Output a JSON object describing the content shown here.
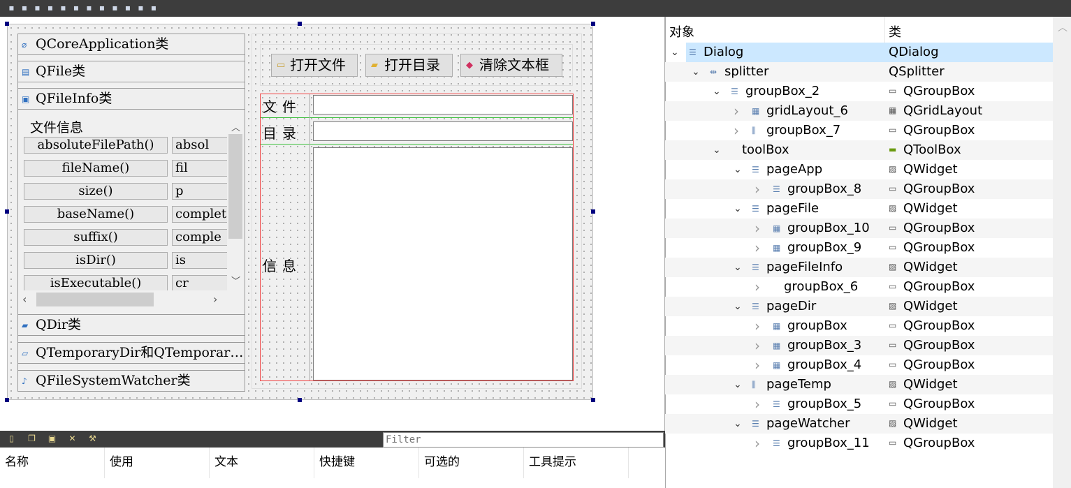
{
  "toolbar": {
    "icons": [
      "edit-widgets-icon",
      "edit-signals-icon",
      "edit-buddies-icon",
      "edit-tab-order-icon",
      "layout-horizontal-icon",
      "layout-vertical-icon",
      "splitter-horizontal-icon",
      "splitter-vertical-icon",
      "layout-form-icon",
      "layout-grid-icon",
      "break-layout-icon",
      "adjust-size-icon"
    ]
  },
  "form": {
    "toolbox_pages": [
      {
        "label": "QCoreApplication类",
        "icon": "paperclip-icon"
      },
      {
        "label": "QFile类",
        "icon": "file-icon"
      },
      {
        "label": "QFileInfo类",
        "icon": "file-info-icon"
      },
      {
        "label": "QDir类",
        "icon": "folder-icon"
      },
      {
        "label": "QTemporaryDir和QTemporar…",
        "icon": "temp-file-icon"
      },
      {
        "label": "QFileSystemWatcher类",
        "icon": "bell-icon"
      }
    ],
    "group_title": "文件信息",
    "func_buttons": [
      [
        "absoluteFilePath()",
        "absol"
      ],
      [
        "fileName()",
        "fil"
      ],
      [
        "size()",
        "p"
      ],
      [
        "baseName()",
        "complet"
      ],
      [
        "suffix()",
        "comple"
      ],
      [
        "isDir()",
        "is"
      ],
      [
        "isExecutable()",
        "cr"
      ]
    ],
    "buttons": {
      "open_file": "打开文件",
      "open_dir": "打开目录",
      "clear": "清除文本框"
    },
    "labels": {
      "file": "文件",
      "dir": "目录",
      "info": "信息"
    },
    "inputs": {
      "file": "",
      "dir": "",
      "info": ""
    }
  },
  "actions": {
    "icons": [
      "new-action-icon",
      "copy-action-icon",
      "paste-action-icon",
      "delete-action-icon",
      "configure-icon"
    ],
    "filter_placeholder": "Filter",
    "columns": [
      "名称",
      "使用",
      "文本",
      "快捷键",
      "可选的",
      "工具提示"
    ]
  },
  "inspector": {
    "headers": {
      "object": "对象",
      "class": "类"
    },
    "selected_color": "#cce8ff",
    "rows": [
      {
        "name": "Dialog",
        "class": "QDialog",
        "level": 0,
        "state": "expanded",
        "icon": "vertical-layout-icon",
        "class_icon": ""
      },
      {
        "name": "splitter",
        "class": "QSplitter",
        "level": 1,
        "state": "expanded",
        "icon": "splitter-icon",
        "class_icon": ""
      },
      {
        "name": "groupBox_2",
        "class": "QGroupBox",
        "level": 2,
        "state": "expanded",
        "icon": "vertical-layout-icon",
        "class_icon": "groupbox-icon"
      },
      {
        "name": "gridLayout_6",
        "class": "QGridLayout",
        "level": 3,
        "state": "collapsed",
        "icon": "grid-layout-icon",
        "class_icon": "grid-layout-icon"
      },
      {
        "name": "groupBox_7",
        "class": "QGroupBox",
        "level": 3,
        "state": "collapsed",
        "icon": "horizontal-layout-icon",
        "class_icon": "groupbox-icon"
      },
      {
        "name": "toolBox",
        "class": "QToolBox",
        "level": 2,
        "state": "expanded",
        "icon": "",
        "class_icon": "toolbox-icon"
      },
      {
        "name": "pageApp",
        "class": "QWidget",
        "level": 3,
        "state": "expanded",
        "icon": "vertical-layout-icon",
        "class_icon": "widget-icon"
      },
      {
        "name": "groupBox_8",
        "class": "QGroupBox",
        "level": 4,
        "state": "collapsed",
        "icon": "vertical-layout-icon",
        "class_icon": "groupbox-icon"
      },
      {
        "name": "pageFile",
        "class": "QWidget",
        "level": 3,
        "state": "expanded",
        "icon": "vertical-layout-icon",
        "class_icon": "widget-icon"
      },
      {
        "name": "groupBox_10",
        "class": "QGroupBox",
        "level": 4,
        "state": "collapsed",
        "icon": "grid-layout-icon",
        "class_icon": "groupbox-icon"
      },
      {
        "name": "groupBox_9",
        "class": "QGroupBox",
        "level": 4,
        "state": "collapsed",
        "icon": "grid-layout-icon",
        "class_icon": "groupbox-icon"
      },
      {
        "name": "pageFileInfo",
        "class": "QWidget",
        "level": 3,
        "state": "expanded",
        "icon": "vertical-layout-icon",
        "class_icon": "widget-icon"
      },
      {
        "name": "groupBox_6",
        "class": "QGroupBox",
        "level": 4,
        "state": "collapsed",
        "icon": "",
        "class_icon": "groupbox-icon"
      },
      {
        "name": "pageDir",
        "class": "QWidget",
        "level": 3,
        "state": "expanded",
        "icon": "vertical-layout-icon",
        "class_icon": "widget-icon"
      },
      {
        "name": "groupBox",
        "class": "QGroupBox",
        "level": 4,
        "state": "collapsed",
        "icon": "grid-layout-icon",
        "class_icon": "groupbox-icon"
      },
      {
        "name": "groupBox_3",
        "class": "QGroupBox",
        "level": 4,
        "state": "collapsed",
        "icon": "grid-layout-icon",
        "class_icon": "groupbox-icon"
      },
      {
        "name": "groupBox_4",
        "class": "QGroupBox",
        "level": 4,
        "state": "collapsed",
        "icon": "grid-layout-icon",
        "class_icon": "groupbox-icon"
      },
      {
        "name": "pageTemp",
        "class": "QWidget",
        "level": 3,
        "state": "expanded",
        "icon": "horizontal-layout-icon",
        "class_icon": "widget-icon"
      },
      {
        "name": "groupBox_5",
        "class": "QGroupBox",
        "level": 4,
        "state": "collapsed",
        "icon": "vertical-layout-icon",
        "class_icon": "groupbox-icon"
      },
      {
        "name": "pageWatcher",
        "class": "QWidget",
        "level": 3,
        "state": "expanded",
        "icon": "vertical-layout-icon",
        "class_icon": "widget-icon"
      },
      {
        "name": "groupBox_11",
        "class": "QGroupBox",
        "level": 4,
        "state": "collapsed",
        "icon": "vertical-layout-icon",
        "class_icon": "groupbox-icon"
      }
    ]
  }
}
